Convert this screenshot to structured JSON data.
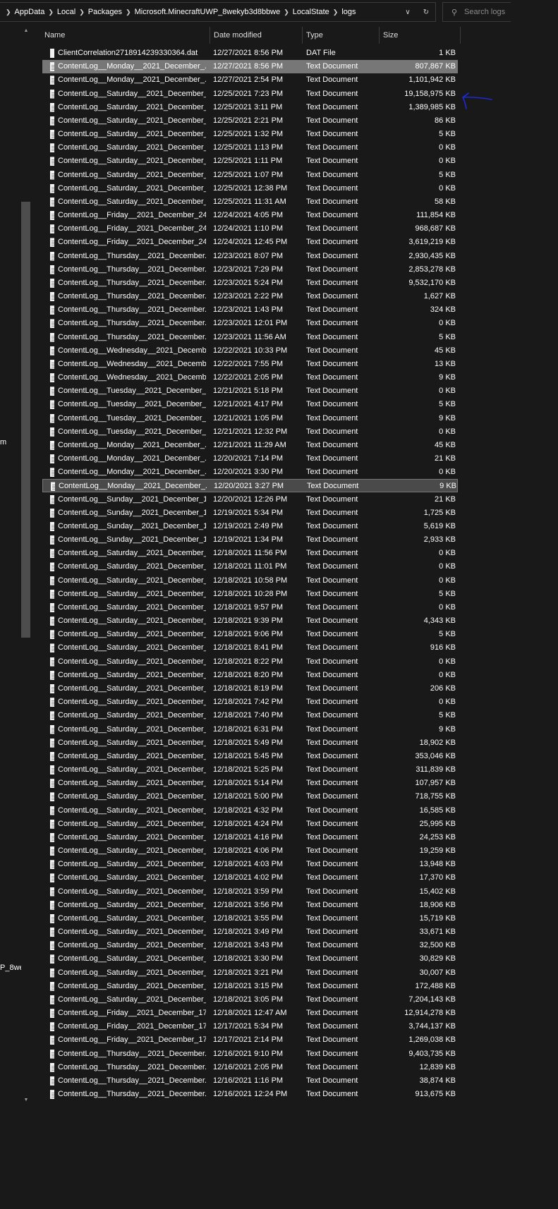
{
  "addressbar": {
    "path": [
      "AppData",
      "Local",
      "Packages",
      "Microsoft.MinecraftUWP_8wekyb3d8bbwe",
      "LocalState",
      "logs"
    ],
    "search_placeholder": "Search logs"
  },
  "nav_fragments": [
    "m",
    "P_8we"
  ],
  "columns": {
    "name": "Name",
    "date": "Date modified",
    "type": "Type",
    "size": "Size"
  },
  "files": [
    {
      "name": "ClientCorrelation2718914239330364.dat",
      "date": "12/27/2021 8:56 PM",
      "type": "DAT File",
      "size": "1 KB"
    },
    {
      "name": "ContentLog__Monday__2021_December_...",
      "date": "12/27/2021 8:56 PM",
      "type": "Text Document",
      "size": "807,867 KB"
    },
    {
      "name": "ContentLog__Monday__2021_December_...",
      "date": "12/27/2021 2:54 PM",
      "type": "Text Document",
      "size": "1,101,942 KB"
    },
    {
      "name": "ContentLog__Saturday__2021_December_...",
      "date": "12/25/2021 7:23 PM",
      "type": "Text Document",
      "size": "19,158,975 KB"
    },
    {
      "name": "ContentLog__Saturday__2021_December_...",
      "date": "12/25/2021 3:11 PM",
      "type": "Text Document",
      "size": "1,389,985 KB"
    },
    {
      "name": "ContentLog__Saturday__2021_December_...",
      "date": "12/25/2021 2:21 PM",
      "type": "Text Document",
      "size": "86 KB"
    },
    {
      "name": "ContentLog__Saturday__2021_December_...",
      "date": "12/25/2021 1:32 PM",
      "type": "Text Document",
      "size": "5 KB"
    },
    {
      "name": "ContentLog__Saturday__2021_December_...",
      "date": "12/25/2021 1:13 PM",
      "type": "Text Document",
      "size": "0 KB"
    },
    {
      "name": "ContentLog__Saturday__2021_December_...",
      "date": "12/25/2021 1:11 PM",
      "type": "Text Document",
      "size": "0 KB"
    },
    {
      "name": "ContentLog__Saturday__2021_December_...",
      "date": "12/25/2021 1:07 PM",
      "type": "Text Document",
      "size": "5 KB"
    },
    {
      "name": "ContentLog__Saturday__2021_December_...",
      "date": "12/25/2021 12:38 PM",
      "type": "Text Document",
      "size": "0 KB"
    },
    {
      "name": "ContentLog__Saturday__2021_December_...",
      "date": "12/25/2021 11:31 AM",
      "type": "Text Document",
      "size": "58 KB"
    },
    {
      "name": "ContentLog__Friday__2021_December_24...",
      "date": "12/24/2021 4:05 PM",
      "type": "Text Document",
      "size": "111,854 KB"
    },
    {
      "name": "ContentLog__Friday__2021_December_24...",
      "date": "12/24/2021 1:10 PM",
      "type": "Text Document",
      "size": "968,687 KB"
    },
    {
      "name": "ContentLog__Friday__2021_December_24...",
      "date": "12/24/2021 12:45 PM",
      "type": "Text Document",
      "size": "3,619,219 KB"
    },
    {
      "name": "ContentLog__Thursday__2021_December...",
      "date": "12/23/2021 8:07 PM",
      "type": "Text Document",
      "size": "2,930,435 KB"
    },
    {
      "name": "ContentLog__Thursday__2021_December...",
      "date": "12/23/2021 7:29 PM",
      "type": "Text Document",
      "size": "2,853,278 KB"
    },
    {
      "name": "ContentLog__Thursday__2021_December...",
      "date": "12/23/2021 5:24 PM",
      "type": "Text Document",
      "size": "9,532,170 KB"
    },
    {
      "name": "ContentLog__Thursday__2021_December...",
      "date": "12/23/2021 2:22 PM",
      "type": "Text Document",
      "size": "1,627 KB"
    },
    {
      "name": "ContentLog__Thursday__2021_December...",
      "date": "12/23/2021 1:43 PM",
      "type": "Text Document",
      "size": "324 KB"
    },
    {
      "name": "ContentLog__Thursday__2021_December...",
      "date": "12/23/2021 12:01 PM",
      "type": "Text Document",
      "size": "0 KB"
    },
    {
      "name": "ContentLog__Thursday__2021_December...",
      "date": "12/23/2021 11:56 AM",
      "type": "Text Document",
      "size": "5 KB"
    },
    {
      "name": "ContentLog__Wednesday__2021_Decemb...",
      "date": "12/22/2021 10:33 PM",
      "type": "Text Document",
      "size": "45 KB"
    },
    {
      "name": "ContentLog__Wednesday__2021_Decemb...",
      "date": "12/22/2021 7:55 PM",
      "type": "Text Document",
      "size": "13 KB"
    },
    {
      "name": "ContentLog__Wednesday__2021_Decemb...",
      "date": "12/22/2021 2:05 PM",
      "type": "Text Document",
      "size": "9 KB"
    },
    {
      "name": "ContentLog__Tuesday__2021_December_...",
      "date": "12/21/2021 5:18 PM",
      "type": "Text Document",
      "size": "0 KB"
    },
    {
      "name": "ContentLog__Tuesday__2021_December_...",
      "date": "12/21/2021 4:17 PM",
      "type": "Text Document",
      "size": "5 KB"
    },
    {
      "name": "ContentLog__Tuesday__2021_December_...",
      "date": "12/21/2021 1:05 PM",
      "type": "Text Document",
      "size": "9 KB"
    },
    {
      "name": "ContentLog__Tuesday__2021_December_...",
      "date": "12/21/2021 12:32 PM",
      "type": "Text Document",
      "size": "0 KB"
    },
    {
      "name": "ContentLog__Monday__2021_December_...",
      "date": "12/21/2021 11:29 AM",
      "type": "Text Document",
      "size": "45 KB"
    },
    {
      "name": "ContentLog__Monday__2021_December_...",
      "date": "12/20/2021 7:14 PM",
      "type": "Text Document",
      "size": "21 KB"
    },
    {
      "name": "ContentLog__Monday__2021_December_...",
      "date": "12/20/2021 3:30 PM",
      "type": "Text Document",
      "size": "0 KB"
    },
    {
      "name": "ContentLog__Monday__2021_December_...",
      "date": "12/20/2021 3:27 PM",
      "type": "Text Document",
      "size": "9 KB"
    },
    {
      "name": "ContentLog__Sunday__2021_December_1...",
      "date": "12/20/2021 12:26 PM",
      "type": "Text Document",
      "size": "21 KB"
    },
    {
      "name": "ContentLog__Sunday__2021_December_1...",
      "date": "12/19/2021 5:34 PM",
      "type": "Text Document",
      "size": "1,725 KB"
    },
    {
      "name": "ContentLog__Sunday__2021_December_1...",
      "date": "12/19/2021 2:49 PM",
      "type": "Text Document",
      "size": "5,619 KB"
    },
    {
      "name": "ContentLog__Sunday__2021_December_1...",
      "date": "12/19/2021 1:34 PM",
      "type": "Text Document",
      "size": "2,933 KB"
    },
    {
      "name": "ContentLog__Saturday__2021_December_...",
      "date": "12/18/2021 11:56 PM",
      "type": "Text Document",
      "size": "0 KB"
    },
    {
      "name": "ContentLog__Saturday__2021_December_...",
      "date": "12/18/2021 11:01 PM",
      "type": "Text Document",
      "size": "0 KB"
    },
    {
      "name": "ContentLog__Saturday__2021_December_...",
      "date": "12/18/2021 10:58 PM",
      "type": "Text Document",
      "size": "0 KB"
    },
    {
      "name": "ContentLog__Saturday__2021_December_...",
      "date": "12/18/2021 10:28 PM",
      "type": "Text Document",
      "size": "5 KB"
    },
    {
      "name": "ContentLog__Saturday__2021_December_...",
      "date": "12/18/2021 9:57 PM",
      "type": "Text Document",
      "size": "0 KB"
    },
    {
      "name": "ContentLog__Saturday__2021_December_...",
      "date": "12/18/2021 9:39 PM",
      "type": "Text Document",
      "size": "4,343 KB"
    },
    {
      "name": "ContentLog__Saturday__2021_December_...",
      "date": "12/18/2021 9:06 PM",
      "type": "Text Document",
      "size": "5 KB"
    },
    {
      "name": "ContentLog__Saturday__2021_December_...",
      "date": "12/18/2021 8:41 PM",
      "type": "Text Document",
      "size": "916 KB"
    },
    {
      "name": "ContentLog__Saturday__2021_December_...",
      "date": "12/18/2021 8:22 PM",
      "type": "Text Document",
      "size": "0 KB"
    },
    {
      "name": "ContentLog__Saturday__2021_December_...",
      "date": "12/18/2021 8:20 PM",
      "type": "Text Document",
      "size": "0 KB"
    },
    {
      "name": "ContentLog__Saturday__2021_December_...",
      "date": "12/18/2021 8:19 PM",
      "type": "Text Document",
      "size": "206 KB"
    },
    {
      "name": "ContentLog__Saturday__2021_December_...",
      "date": "12/18/2021 7:42 PM",
      "type": "Text Document",
      "size": "0 KB"
    },
    {
      "name": "ContentLog__Saturday__2021_December_...",
      "date": "12/18/2021 7:40 PM",
      "type": "Text Document",
      "size": "5 KB"
    },
    {
      "name": "ContentLog__Saturday__2021_December_...",
      "date": "12/18/2021 6:31 PM",
      "type": "Text Document",
      "size": "9 KB"
    },
    {
      "name": "ContentLog__Saturday__2021_December_...",
      "date": "12/18/2021 5:49 PM",
      "type": "Text Document",
      "size": "18,902 KB"
    },
    {
      "name": "ContentLog__Saturday__2021_December_...",
      "date": "12/18/2021 5:45 PM",
      "type": "Text Document",
      "size": "353,046 KB"
    },
    {
      "name": "ContentLog__Saturday__2021_December_...",
      "date": "12/18/2021 5:25 PM",
      "type": "Text Document",
      "size": "311,839 KB"
    },
    {
      "name": "ContentLog__Saturday__2021_December_...",
      "date": "12/18/2021 5:14 PM",
      "type": "Text Document",
      "size": "107,957 KB"
    },
    {
      "name": "ContentLog__Saturday__2021_December_...",
      "date": "12/18/2021 5:00 PM",
      "type": "Text Document",
      "size": "718,755 KB"
    },
    {
      "name": "ContentLog__Saturday__2021_December_...",
      "date": "12/18/2021 4:32 PM",
      "type": "Text Document",
      "size": "16,585 KB"
    },
    {
      "name": "ContentLog__Saturday__2021_December_...",
      "date": "12/18/2021 4:24 PM",
      "type": "Text Document",
      "size": "25,995 KB"
    },
    {
      "name": "ContentLog__Saturday__2021_December_...",
      "date": "12/18/2021 4:16 PM",
      "type": "Text Document",
      "size": "24,253 KB"
    },
    {
      "name": "ContentLog__Saturday__2021_December_...",
      "date": "12/18/2021 4:06 PM",
      "type": "Text Document",
      "size": "19,259 KB"
    },
    {
      "name": "ContentLog__Saturday__2021_December_...",
      "date": "12/18/2021 4:03 PM",
      "type": "Text Document",
      "size": "13,948 KB"
    },
    {
      "name": "ContentLog__Saturday__2021_December_...",
      "date": "12/18/2021 4:02 PM",
      "type": "Text Document",
      "size": "17,370 KB"
    },
    {
      "name": "ContentLog__Saturday__2021_December_...",
      "date": "12/18/2021 3:59 PM",
      "type": "Text Document",
      "size": "15,402 KB"
    },
    {
      "name": "ContentLog__Saturday__2021_December_...",
      "date": "12/18/2021 3:56 PM",
      "type": "Text Document",
      "size": "18,906 KB"
    },
    {
      "name": "ContentLog__Saturday__2021_December_...",
      "date": "12/18/2021 3:55 PM",
      "type": "Text Document",
      "size": "15,719 KB"
    },
    {
      "name": "ContentLog__Saturday__2021_December_...",
      "date": "12/18/2021 3:49 PM",
      "type": "Text Document",
      "size": "33,671 KB"
    },
    {
      "name": "ContentLog__Saturday__2021_December_...",
      "date": "12/18/2021 3:43 PM",
      "type": "Text Document",
      "size": "32,500 KB"
    },
    {
      "name": "ContentLog__Saturday__2021_December_...",
      "date": "12/18/2021 3:30 PM",
      "type": "Text Document",
      "size": "30,829 KB"
    },
    {
      "name": "ContentLog__Saturday__2021_December_...",
      "date": "12/18/2021 3:21 PM",
      "type": "Text Document",
      "size": "30,007 KB"
    },
    {
      "name": "ContentLog__Saturday__2021_December_...",
      "date": "12/18/2021 3:15 PM",
      "type": "Text Document",
      "size": "172,488 KB"
    },
    {
      "name": "ContentLog__Saturday__2021_December_...",
      "date": "12/18/2021 3:05 PM",
      "type": "Text Document",
      "size": "7,204,143 KB"
    },
    {
      "name": "ContentLog__Friday__2021_December_17...",
      "date": "12/18/2021 12:47 AM",
      "type": "Text Document",
      "size": "12,914,278 KB"
    },
    {
      "name": "ContentLog__Friday__2021_December_17...",
      "date": "12/17/2021 5:34 PM",
      "type": "Text Document",
      "size": "3,744,137 KB"
    },
    {
      "name": "ContentLog__Friday__2021_December_17...",
      "date": "12/17/2021 2:14 PM",
      "type": "Text Document",
      "size": "1,269,038 KB"
    },
    {
      "name": "ContentLog__Thursday__2021_December...",
      "date": "12/16/2021 9:10 PM",
      "type": "Text Document",
      "size": "9,403,735 KB"
    },
    {
      "name": "ContentLog__Thursday__2021_December...",
      "date": "12/16/2021 2:05 PM",
      "type": "Text Document",
      "size": "12,839 KB"
    },
    {
      "name": "ContentLog__Thursday__2021_December...",
      "date": "12/16/2021 1:16 PM",
      "type": "Text Document",
      "size": "38,874 KB"
    },
    {
      "name": "ContentLog__Thursday__2021_December...",
      "date": "12/16/2021 12:24 PM",
      "type": "Text Document",
      "size": "913,675 KB"
    }
  ],
  "selected_row": 1,
  "hover_row": 32,
  "colors": {
    "background": "#191919",
    "selected": "#777777",
    "annotation_arrow": "#1c2bd6"
  }
}
